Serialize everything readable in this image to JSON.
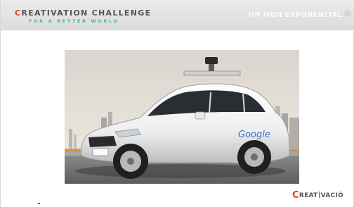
{
  "header": {
    "brand_first_letter": "C",
    "brand_rest": "REATIVATION CHALLENGE",
    "brand_subtitle": "FOR A BETTER WORLD",
    "section_title": "UN MÓN EXPONENCIAL"
  },
  "photo": {
    "car_brand_text": "Google"
  },
  "footer": {
    "logo_first": "C",
    "logo_mid": "REAT",
    "logo_end": "VACIÓ"
  },
  "colors": {
    "brand_red": "#e53a2f",
    "brand_teal": "#4eb49a",
    "header_gray": "#e3e3e3"
  }
}
